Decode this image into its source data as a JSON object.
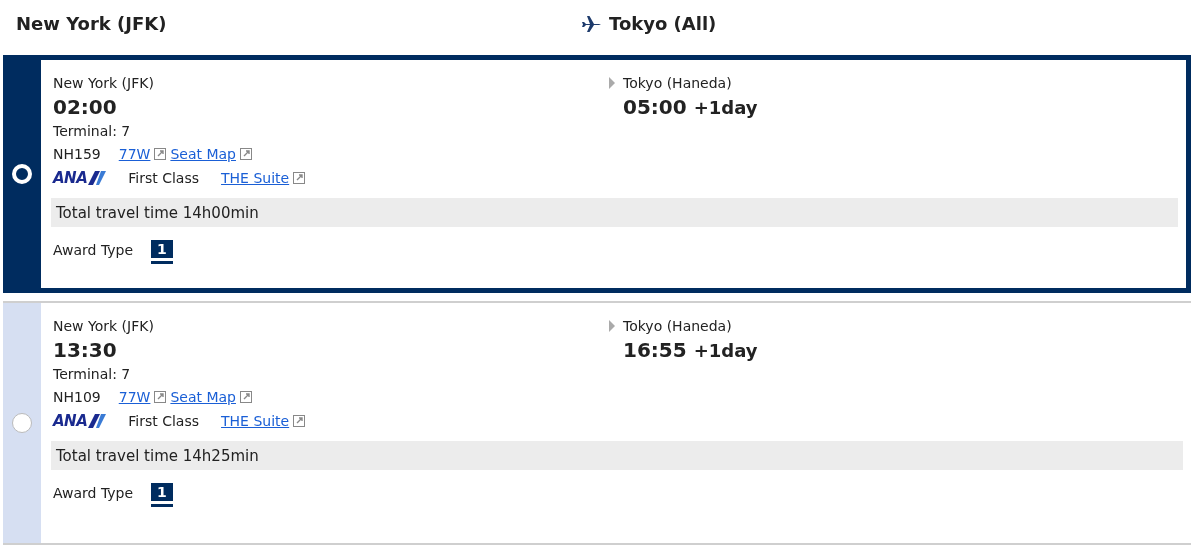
{
  "header": {
    "origin": "New York (JFK)",
    "destination": "Tokyo (All)"
  },
  "flights": [
    {
      "selected": true,
      "origin": "New York (JFK)",
      "departure": "02:00",
      "terminal": "Terminal: 7",
      "flight_number": "NH159",
      "aircraft": "77W",
      "seat_map": "Seat Map",
      "airline_logo": "ANA",
      "cabin": "First Class",
      "seat_product": "THE Suite",
      "destination": "Tokyo (Haneda)",
      "arrival": "05:00",
      "day_offset": "+1day",
      "total_travel_time": "Total travel time 14h00min",
      "award_type_label": "Award Type",
      "award_type": "1"
    },
    {
      "selected": false,
      "origin": "New York (JFK)",
      "departure": "13:30",
      "terminal": "Terminal: 7",
      "flight_number": "NH109",
      "aircraft": "77W",
      "seat_map": "Seat Map",
      "airline_logo": "ANA",
      "cabin": "First Class",
      "seat_product": "THE Suite",
      "destination": "Tokyo (Haneda)",
      "arrival": "16:55",
      "day_offset": "+1day",
      "total_travel_time": "Total travel time 14h25min",
      "award_type_label": "Award Type",
      "award_type": "1"
    }
  ]
}
